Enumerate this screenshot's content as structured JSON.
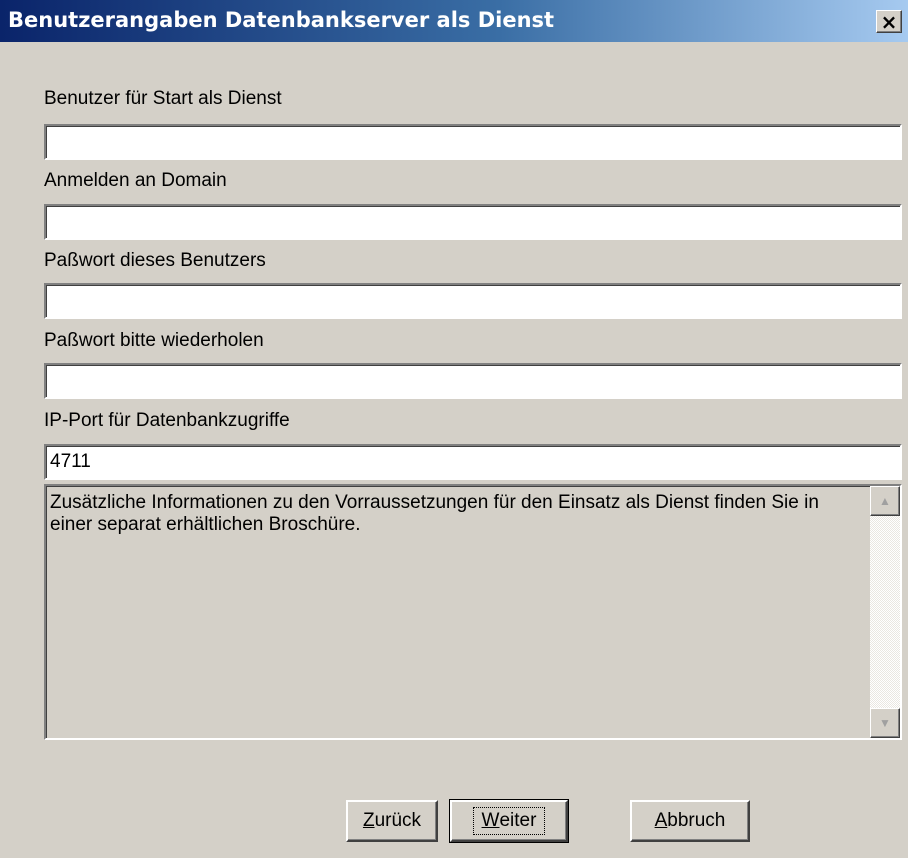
{
  "window": {
    "title": "Benutzerangaben Datenbankserver als Dienst",
    "close_glyph": "×"
  },
  "fields": [
    {
      "label": "Benutzer für Start als Dienst",
      "value": ""
    },
    {
      "label": "Anmelden an Domain",
      "value": ""
    },
    {
      "label": "Paßwort dieses Benutzers",
      "value": ""
    },
    {
      "label": "Paßwort bitte wiederholen",
      "value": ""
    },
    {
      "label": "IP-Port für Datenbankzugriffe",
      "value": "4711"
    }
  ],
  "info": {
    "text": "Zusätzliche Informationen zu den Vorraussetzungen für den Einsatz als Dienst finden Sie in einer separat erhältlichen Broschüre.",
    "scroll_up_glyph": "▲",
    "scroll_down_glyph": "▼"
  },
  "buttons": {
    "back": {
      "mnemonic": "Z",
      "rest": "urück"
    },
    "next": {
      "mnemonic": "W",
      "rest": "eiter"
    },
    "cancel": {
      "mnemonic": "A",
      "rest": "bbruch"
    }
  },
  "colors": {
    "titlebar_start": "#0a246a",
    "titlebar_end": "#a6caf0",
    "dialog_face": "#d4d0c8"
  }
}
